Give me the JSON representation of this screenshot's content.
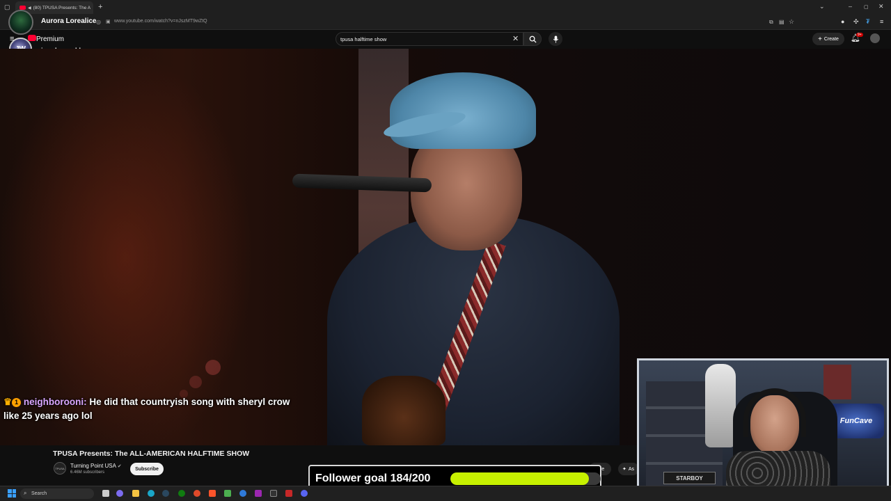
{
  "browser": {
    "tab_title": "(80) TPUSA Presents: The A",
    "url": "www.youtube.com/watch?v=nJszMT9wZtQ"
  },
  "stream": {
    "streamer_name": "Aurora Lorealice",
    "channel_name": "jourdanworld",
    "chat": {
      "username": "neighborooni:",
      "message": " He did that countryish song with sheryl crow like 25 years ago lol"
    },
    "follower_goal": {
      "label": "Follower goal 184/200",
      "current": 184,
      "target": 200
    },
    "webcam": {
      "sign": "FunCave",
      "plate": "STARBOY"
    }
  },
  "youtube": {
    "premium_label": "Premium",
    "search_value": "tpusa halftime show",
    "create_label": "Create",
    "notification_count": "9+",
    "video_title": "TPUSA Presents: The ALL-AMERICAN HALFTIME SHOW",
    "owner_name": "Turning Point USA",
    "owner_subscribers": "6.46M subscribers",
    "subscribe_label": "Subscribe",
    "share_label": "are",
    "ask_label": "As"
  },
  "taskbar": {
    "search_label": "Search"
  },
  "colors": {
    "youtube_red": "#ff0033",
    "goal_fill": "#c6f000",
    "chat_username": "#d9a6ff"
  }
}
